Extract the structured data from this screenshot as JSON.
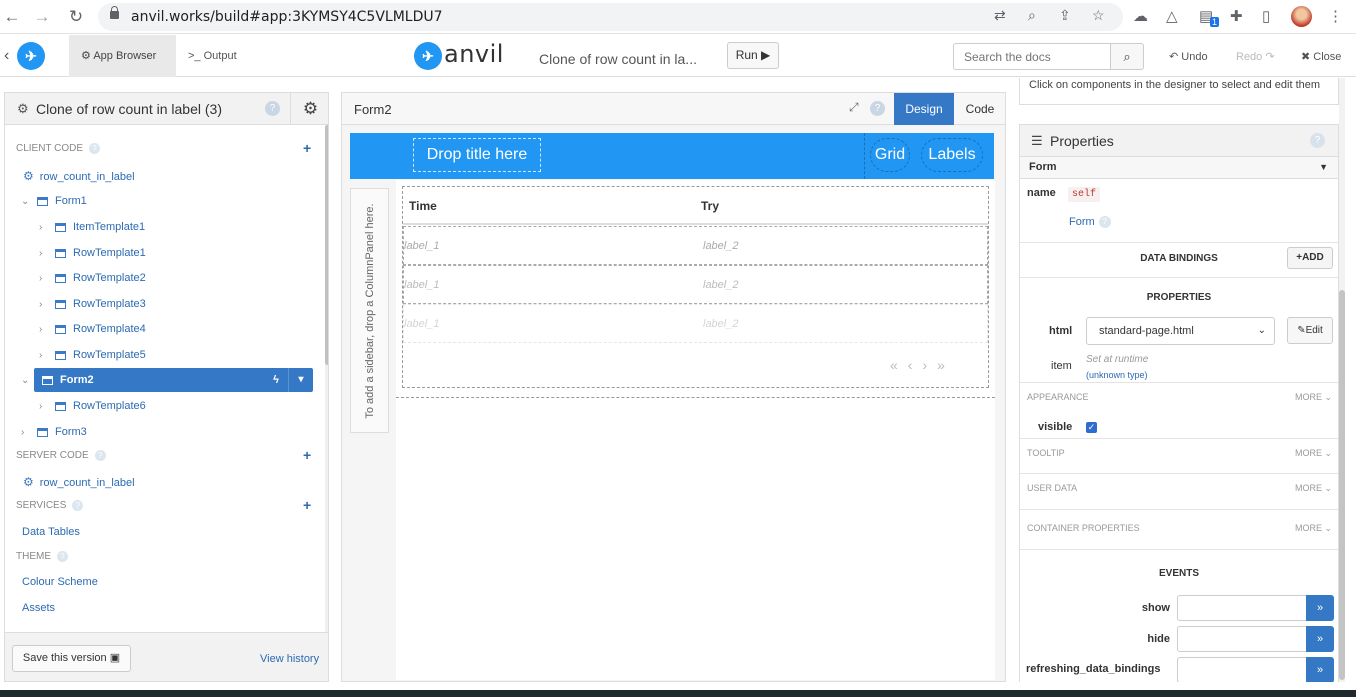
{
  "browser": {
    "url": "anvil.works/build#app:3KYMSY4C5VLMLDU7",
    "ext_badge": "1"
  },
  "toolbar": {
    "app_browser_label": "App Browser",
    "output_label": "Output",
    "brand": "anvil",
    "app_title": "Clone of row count in la...",
    "run_label": "Run ▶",
    "search_placeholder": "Search the docs",
    "undo_label": "Undo",
    "redo_label": "Redo",
    "close_label": "Close"
  },
  "left_panel": {
    "title": "Clone of row count in label (3)",
    "client_code_label": "CLIENT CODE",
    "client_package": "row_count_in_label",
    "forms": [
      {
        "label": "Form1"
      },
      {
        "label": "ItemTemplate1"
      },
      {
        "label": "RowTemplate1"
      },
      {
        "label": "RowTemplate2"
      },
      {
        "label": "RowTemplate3"
      },
      {
        "label": "RowTemplate4"
      },
      {
        "label": "RowTemplate5"
      },
      {
        "label": "Form2"
      },
      {
        "label": "RowTemplate6"
      },
      {
        "label": "Form3"
      }
    ],
    "server_code_label": "SERVER CODE",
    "server_package": "row_count_in_label",
    "services_label": "SERVICES",
    "data_tables": "Data Tables",
    "theme_label": "THEME",
    "colour_scheme": "Colour Scheme",
    "assets": "Assets",
    "save_label": "Save this version",
    "view_history": "View history"
  },
  "designer": {
    "form_name": "Form2",
    "design_tab": "Design",
    "code_tab": "Code",
    "drop_title": "Drop title here",
    "nav_links": [
      "Grid",
      "Labels"
    ],
    "sidebar_hint": "To add a sidebar, drop a ColumnPanel here.",
    "grid": {
      "columns": [
        "Time",
        "Try"
      ],
      "rows": [
        [
          "label_1",
          "label_2"
        ],
        [
          "label_1",
          "label_2"
        ],
        [
          "label_1",
          "label_2"
        ]
      ]
    }
  },
  "properties": {
    "hint": "Click on components in the designer to select and edit them",
    "title": "Properties",
    "component_select": "Form",
    "name_label": "name",
    "name_value": "self",
    "form_link": "Form",
    "data_bindings_title": "DATA BINDINGS",
    "add_label": "+ADD",
    "properties_title": "PROPERTIES",
    "html_label": "html",
    "html_value": "standard-page.html",
    "edit_label": "Edit",
    "item_label": "item",
    "item_value": "Set at runtime",
    "item_type": "(unknown type)",
    "appearance_label": "APPEARANCE",
    "more_label": "MORE",
    "visible_label": "visible",
    "visible_checked": true,
    "tooltip_label": "TOOLTIP",
    "user_data_label": "USER DATA",
    "container_props_label": "CONTAINER PROPERTIES",
    "events_title": "EVENTS",
    "events": [
      "show",
      "hide",
      "refreshing_data_bindings"
    ]
  }
}
